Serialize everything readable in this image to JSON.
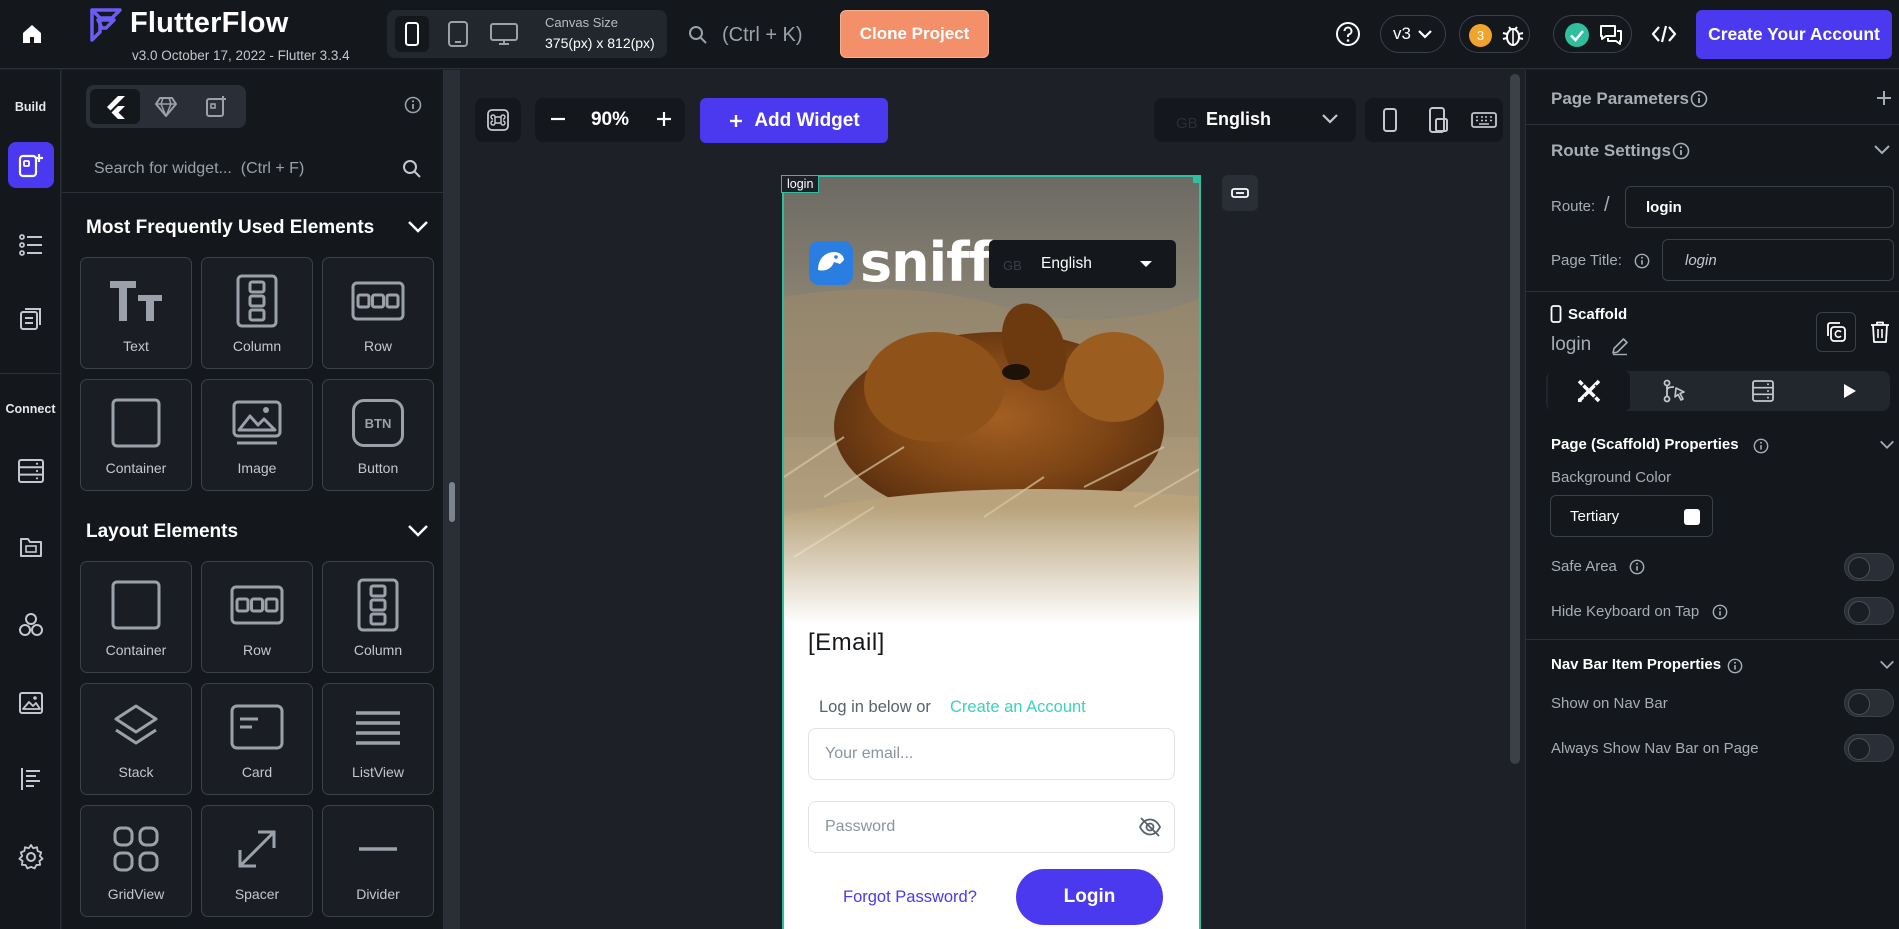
{
  "app": {
    "name": "FlutterFlow",
    "version_line": "v3.0 October 17, 2022 - Flutter 3.3.4"
  },
  "toolbar": {
    "canvas_size_label": "Canvas Size",
    "canvas_size_value": "375(px) x 812(px)",
    "search_shortcut": "(Ctrl + K)",
    "clone_label": "Clone Project",
    "version_label": "v3",
    "notification_count": "3",
    "create_account_label": "Create Your Account"
  },
  "rail": {
    "build_label": "Build",
    "connect_label": "Connect"
  },
  "widget_panel": {
    "search_placeholder": "Search for widget...  (Ctrl + F)",
    "sections": [
      {
        "title": "Most Frequently Used Elements",
        "items": [
          {
            "label": "Text",
            "icon": "text-icon"
          },
          {
            "label": "Column",
            "icon": "column-icon"
          },
          {
            "label": "Row",
            "icon": "row-icon"
          },
          {
            "label": "Container",
            "icon": "container-icon"
          },
          {
            "label": "Image",
            "icon": "image-icon"
          },
          {
            "label": "Button",
            "icon": "button-icon",
            "badge": "BTN"
          }
        ]
      },
      {
        "title": "Layout Elements",
        "items": [
          {
            "label": "Container",
            "icon": "container-icon"
          },
          {
            "label": "Row",
            "icon": "row-icon"
          },
          {
            "label": "Column",
            "icon": "column-icon"
          },
          {
            "label": "Stack",
            "icon": "stack-icon"
          },
          {
            "label": "Card",
            "icon": "card-icon"
          },
          {
            "label": "ListView",
            "icon": "listview-icon"
          },
          {
            "label": "GridView",
            "icon": "gridview-icon"
          },
          {
            "label": "Spacer",
            "icon": "spacer-icon"
          },
          {
            "label": "Divider",
            "icon": "divider-icon"
          }
        ]
      }
    ]
  },
  "canvas": {
    "zoom": "90%",
    "add_widget_label": "Add Widget",
    "lang_flag": "GB",
    "lang_name": "English",
    "page_tag": "login"
  },
  "preview": {
    "logo_text": "sniff",
    "lang_flag": "GB",
    "lang_name": "English",
    "email_title": "[Email]",
    "login_hint": "Log in below or",
    "create_link": "Create an Account",
    "email_placeholder": "Your email...",
    "password_placeholder": "Password",
    "forgot_label": "Forgot Password?",
    "login_label": "Login"
  },
  "props": {
    "page_parameters": "Page Parameters",
    "route_settings": "Route Settings",
    "route_label": "Route:",
    "route_slash": "/",
    "route_value": "login",
    "page_title_label": "Page Title:",
    "page_title_value": "login",
    "scaffold_label": "Scaffold",
    "scaffold_name": "login",
    "scaffold_props": "Page (Scaffold) Properties",
    "background_color_label": "Background Color",
    "background_color_value": "Tertiary",
    "safe_area": "Safe Area",
    "hide_keyboard": "Hide Keyboard on Tap",
    "nav_bar_props": "Nav Bar Item Properties",
    "show_on_nav": "Show on Nav Bar",
    "always_show_nav": "Always Show Nav Bar on Page"
  },
  "colors": {
    "accent": "#4b39ef",
    "clone": "#f3906a",
    "selection": "#2fbf9e",
    "link": "#39d2c0"
  }
}
